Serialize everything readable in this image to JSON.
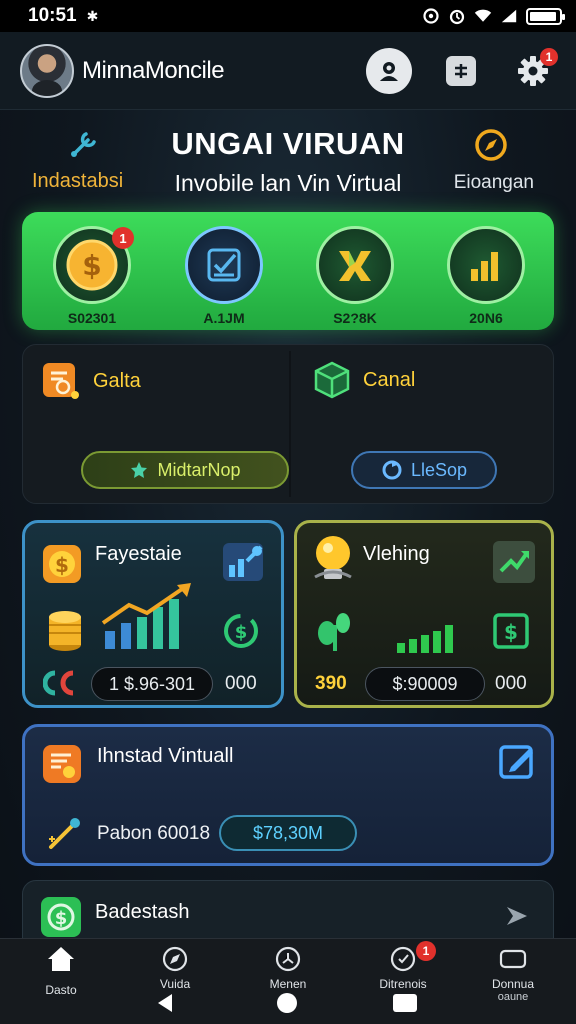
{
  "status_bar": {
    "time": "10:51",
    "bt": "✱"
  },
  "header": {
    "app_name": "MinnaMoncile",
    "settings_badge": "1"
  },
  "hero": {
    "title": "UNGAI VIRUAN",
    "subtitle": "Invobile lan Vin Virtual",
    "left_label": "Indastabsi",
    "right_label": "Eioangan"
  },
  "stats": {
    "items": [
      {
        "value": "S02301",
        "icon": "dollar-coin-icon",
        "badge": "1"
      },
      {
        "value": "A.1JM",
        "icon": "checklist-icon"
      },
      {
        "value": "S2?8K",
        "icon": "k-logo-icon"
      },
      {
        "value": "20N6",
        "icon": "bar-chart-icon"
      }
    ]
  },
  "panel": {
    "left": {
      "title": "Galta",
      "button": "MidtarNop"
    },
    "right": {
      "title": "Canal",
      "button": "LleSop"
    }
  },
  "cards": {
    "left": {
      "title": "Fayestaie",
      "amount": "1 $.96-301",
      "count": "000"
    },
    "right": {
      "title": "Vlehing",
      "prefix": "390",
      "amount": "$:90009",
      "count": "000"
    }
  },
  "wide": {
    "title": "Ihnstad Vintuall",
    "label": "Pabon 60018",
    "amount": "$78,30M"
  },
  "bottom_card": {
    "title": "Badestash"
  },
  "nav": {
    "items": [
      {
        "label": "Dasto"
      },
      {
        "label": "Vuida"
      },
      {
        "label": "Menen"
      },
      {
        "label": "Ditrenois",
        "badge": "1"
      },
      {
        "label": "Donnua",
        "sub": "oaune"
      }
    ]
  },
  "colors": {
    "accent_green": "#2fc94e",
    "accent_gold": "#ffd23b",
    "badge_red": "#e1312c"
  }
}
